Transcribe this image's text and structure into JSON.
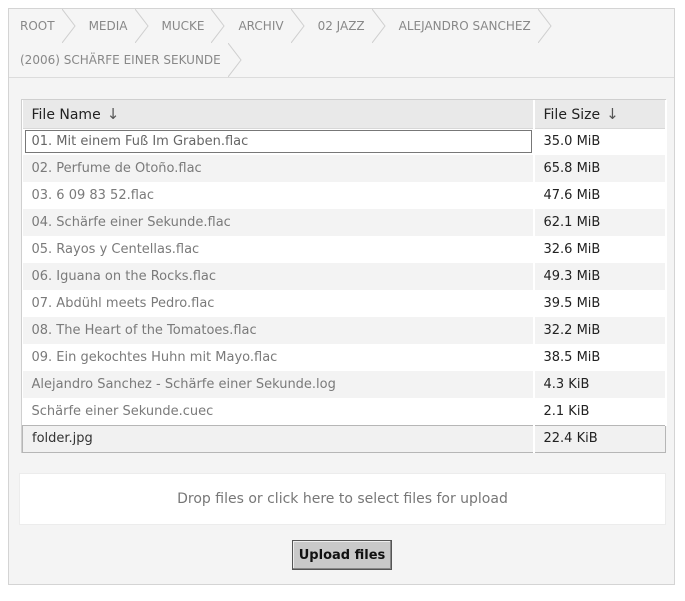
{
  "breadcrumb": [
    "ROOT",
    "MEDIA",
    "MUCKE",
    "ARCHIV",
    "02 JAZZ",
    "ALEJANDRO SANCHEZ",
    "(2006) SCHÄRFE EINER SEKUNDE"
  ],
  "table": {
    "headers": {
      "name": "File Name",
      "size": "File Size"
    },
    "sort_arrow": "↓",
    "rows": [
      {
        "name": "01. Mit einem Fuß Im Graben.flac",
        "size": "35.0 MiB"
      },
      {
        "name": "02. Perfume de Otoño.flac",
        "size": "65.8 MiB"
      },
      {
        "name": "03. 6 09 83 52.flac",
        "size": "47.6 MiB"
      },
      {
        "name": "04. Schärfe einer Sekunde.flac",
        "size": "62.1 MiB"
      },
      {
        "name": "05. Rayos y Centellas.flac",
        "size": "32.6 MiB"
      },
      {
        "name": "06. Iguana on the Rocks.flac",
        "size": "49.3 MiB"
      },
      {
        "name": "07. Abdühl meets Pedro.flac",
        "size": "39.5 MiB"
      },
      {
        "name": "08. The Heart of the Tomatoes.flac",
        "size": "32.2 MiB"
      },
      {
        "name": "09. Ein gekochtes Huhn mit Mayo.flac",
        "size": "38.5 MiB"
      },
      {
        "name": "Alejandro Sanchez - Schärfe einer Sekunde.log",
        "size": "4.3 KiB"
      },
      {
        "name": "Schärfe einer Sekunde.cuec",
        "size": "2.1 KiB"
      },
      {
        "name": "folder.jpg",
        "size": "22.4 KiB"
      }
    ]
  },
  "dropzone": {
    "text": "Drop files or click here to select files for upload"
  },
  "upload_button": {
    "label": "Upload files"
  }
}
